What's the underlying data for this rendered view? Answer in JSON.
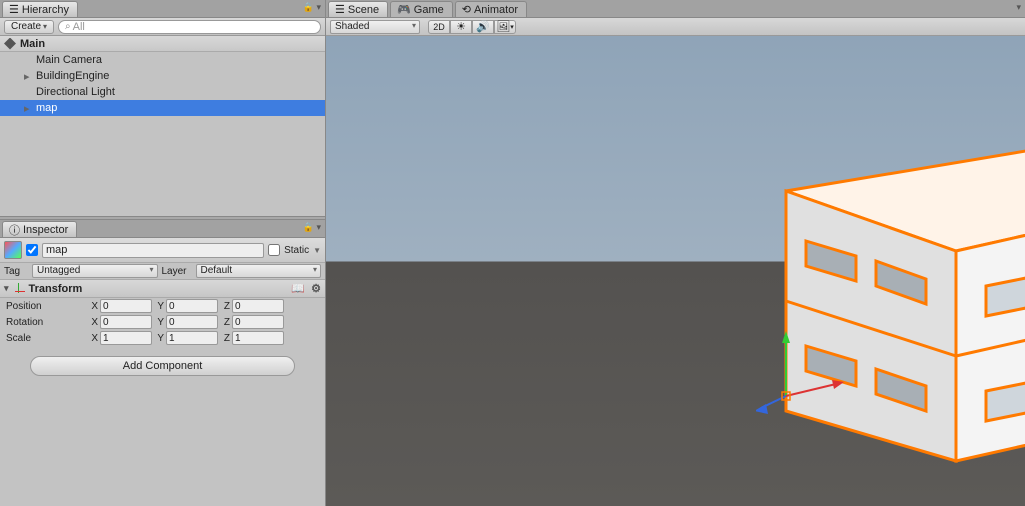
{
  "hierarchy": {
    "tab": "Hierarchy",
    "create": "Create",
    "searchPlaceholder": "All",
    "scene": "Main",
    "items": [
      {
        "label": "Main Camera",
        "hasChildren": false,
        "selected": false
      },
      {
        "label": "BuildingEngine",
        "hasChildren": true,
        "selected": false
      },
      {
        "label": "Directional Light",
        "hasChildren": false,
        "selected": false
      },
      {
        "label": "map",
        "hasChildren": true,
        "selected": true
      }
    ]
  },
  "inspector": {
    "tab": "Inspector",
    "name": "map",
    "staticLabel": "Static",
    "tagLabel": "Tag",
    "tagValue": "Untagged",
    "layerLabel": "Layer",
    "layerValue": "Default",
    "transform": {
      "title": "Transform",
      "rows": [
        {
          "label": "Position",
          "x": "0",
          "y": "0",
          "z": "0"
        },
        {
          "label": "Rotation",
          "x": "0",
          "y": "0",
          "z": "0"
        },
        {
          "label": "Scale",
          "x": "1",
          "y": "1",
          "z": "1"
        }
      ]
    },
    "addComponent": "Add Component"
  },
  "scene": {
    "tabs": [
      "Scene",
      "Game",
      "Animator"
    ],
    "shading": "Shaded",
    "mode2d": "2D"
  }
}
